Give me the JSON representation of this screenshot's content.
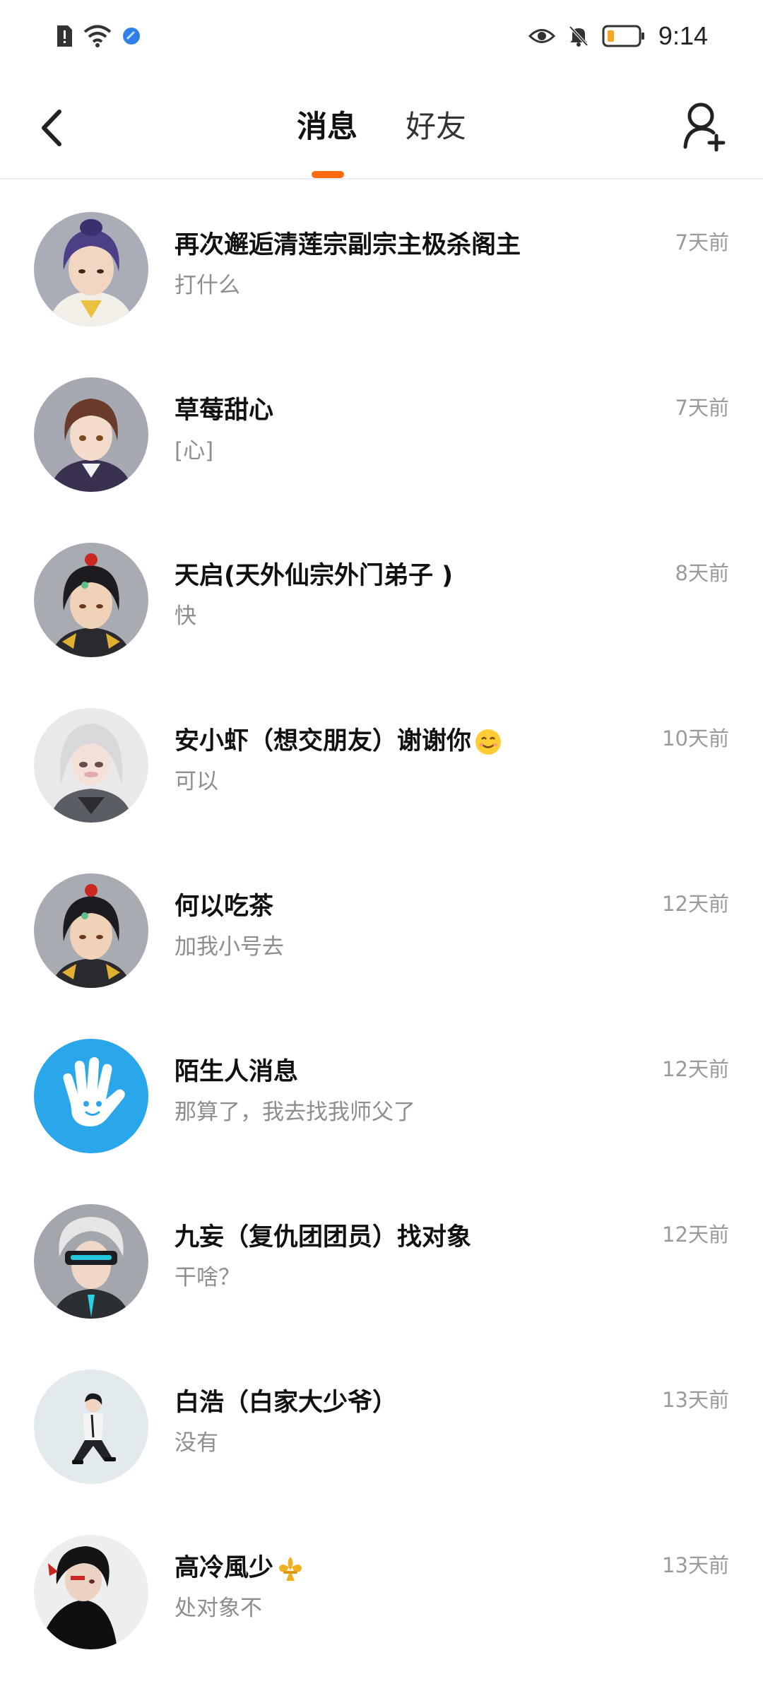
{
  "status_bar": {
    "time": "9:14",
    "icons": [
      "alert-icon",
      "wifi-icon",
      "app-badge-icon",
      "eye-icon",
      "mute-icon",
      "battery-icon"
    ]
  },
  "header": {
    "tabs": [
      {
        "label": "消息",
        "active": true
      },
      {
        "label": "好友",
        "active": false
      }
    ],
    "accent_color": "#ff6a13"
  },
  "conversations": [
    {
      "name": "再次邂逅清莲宗副宗主极杀阁主",
      "preview": "打什么",
      "time": "7天前",
      "avatar": "anime-purple-hair-avatar"
    },
    {
      "name": "草莓甜心",
      "preview": "[心]",
      "time": "7天前",
      "avatar": "anime-brown-hair-avatar"
    },
    {
      "name": "天启(天外仙宗外门弟子 )",
      "preview": "快",
      "time": "8天前",
      "avatar": "anime-black-hair-avatar"
    },
    {
      "name": "安小虾（想交朋友）谢谢你",
      "emoji": "smile-emoji",
      "preview": "可以",
      "time": "10天前",
      "avatar": "anime-white-hair-avatar"
    },
    {
      "name": "何以吃茶",
      "preview": "加我小号去",
      "time": "12天前",
      "avatar": "anime-black-hair-avatar"
    },
    {
      "name": "陌生人消息",
      "preview": "那算了，我去找我师父了",
      "time": "12天前",
      "avatar": "stranger-hand-icon"
    },
    {
      "name": "九妄（复仇团团员）找对象",
      "preview": "干啥？",
      "time": "12天前",
      "avatar": "anime-visor-avatar"
    },
    {
      "name": "白浩（白家大少爷）",
      "preview": "没有",
      "time": "13天前",
      "avatar": "anime-sitting-figure-avatar"
    },
    {
      "name": "高冷風少",
      "emoji": "fleur-de-lis-emoji",
      "preview": "处对象不",
      "time": "13天前",
      "avatar": "anime-dark-figure-avatar"
    }
  ]
}
